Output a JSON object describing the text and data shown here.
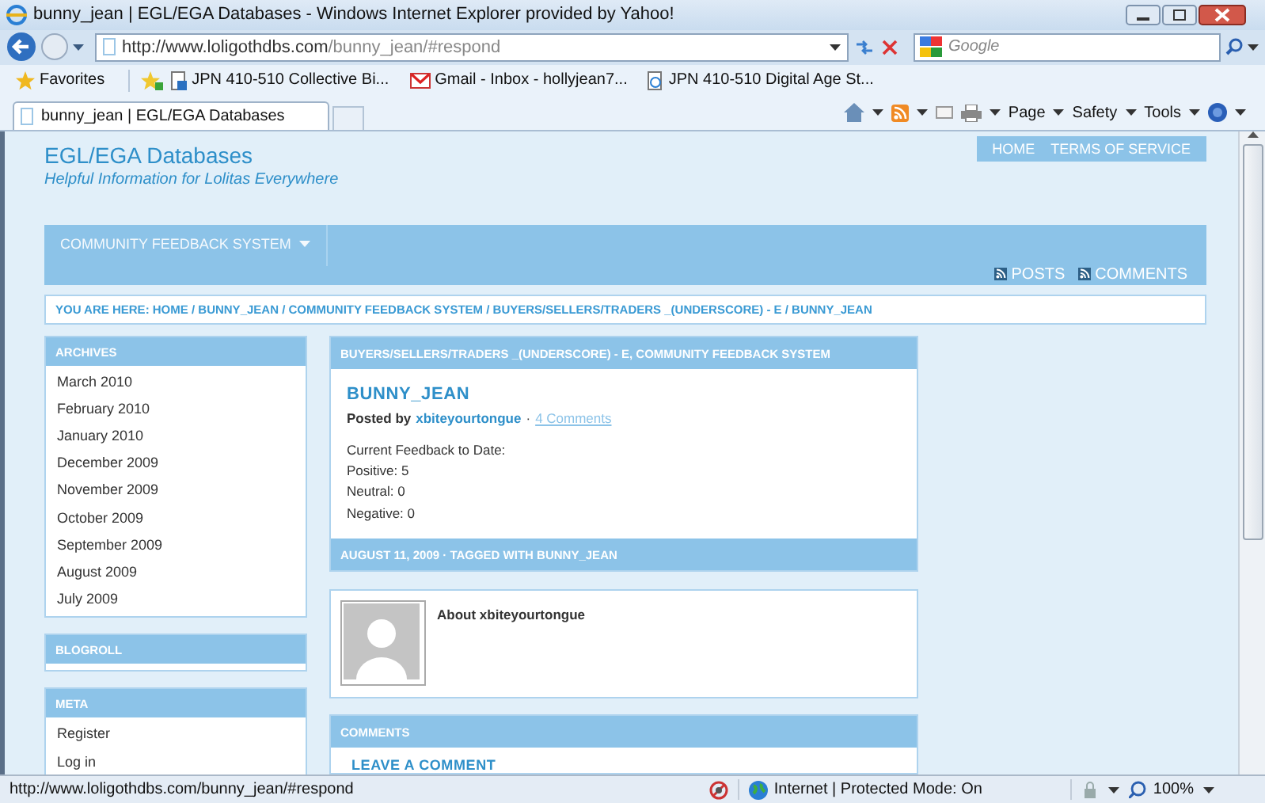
{
  "window": {
    "title": "bunny_jean | EGL/EGA Databases - Windows Internet Explorer provided by Yahoo!"
  },
  "address_bar": {
    "url_domain": "http://www.loligothdbs.com",
    "url_path": "/bunny_jean/#respond",
    "search_placeholder": "Google"
  },
  "favorites_bar": {
    "label": "Favorites",
    "items": [
      {
        "kind": "page",
        "label": "JPN 410-510 Collective Bi..."
      },
      {
        "kind": "mail",
        "label": "Gmail - Inbox - hollyjean7..."
      },
      {
        "kind": "ie",
        "label": "JPN 410-510 Digital Age St..."
      }
    ]
  },
  "tabs": [
    {
      "label": "bunny_jean | EGL/EGA Databases",
      "selected": true
    }
  ],
  "command_bar": [
    "Page",
    "Safety",
    "Tools"
  ],
  "site": {
    "title": "EGL/EGA Databases",
    "tagline": "Helpful Information for Lolitas Everywhere",
    "nav": [
      "HOME",
      "TERMS OF SERVICE"
    ],
    "menu": [
      "COMMUNITY FEEDBACK SYSTEM"
    ],
    "feeds": [
      "POSTS",
      "COMMENTS"
    ],
    "breadcrumb": "YOU ARE HERE: HOME / BUNNY_JEAN / COMMUNITY FEEDBACK SYSTEM / BUYERS/SELLERS/TRADERS _(UNDERSCORE) - E / BUNNY_JEAN"
  },
  "sidebar": [
    {
      "title": "ARCHIVES",
      "items": [
        "March 2010",
        "February 2010",
        "January 2010",
        "December 2009",
        "November 2009",
        "October 2009",
        "September 2009",
        "August 2009",
        "July 2009"
      ]
    },
    {
      "title": "BLOGROLL"
    },
    {
      "title": "META",
      "items": [
        "Register",
        "Log in"
      ]
    }
  ],
  "post": {
    "category": "BUYERS/SELLERS/TRADERS _(UNDERSCORE) - E, COMMUNITY FEEDBACK SYSTEM",
    "title": "BUNNY_JEAN",
    "posted_by": "Posted by",
    "author": "xbiteyourtongue",
    "separator": "·",
    "comments_link": "4 Comments",
    "body": [
      "Current Feedback to Date:",
      "Positive: 5",
      "Neutral: 0",
      "Negative: 0"
    ],
    "footer": "AUGUST 11, 2009 · TAGGED WITH BUNNY_JEAN",
    "about": "About xbiteyourtongue"
  },
  "comments": {
    "title": "COMMENTS",
    "leave": "LEAVE A COMMENT"
  },
  "status_bar": {
    "url": "http://www.loligothdbs.com/bunny_jean/#respond",
    "zone": "Internet | Protected Mode: On",
    "zoom": "100%"
  }
}
